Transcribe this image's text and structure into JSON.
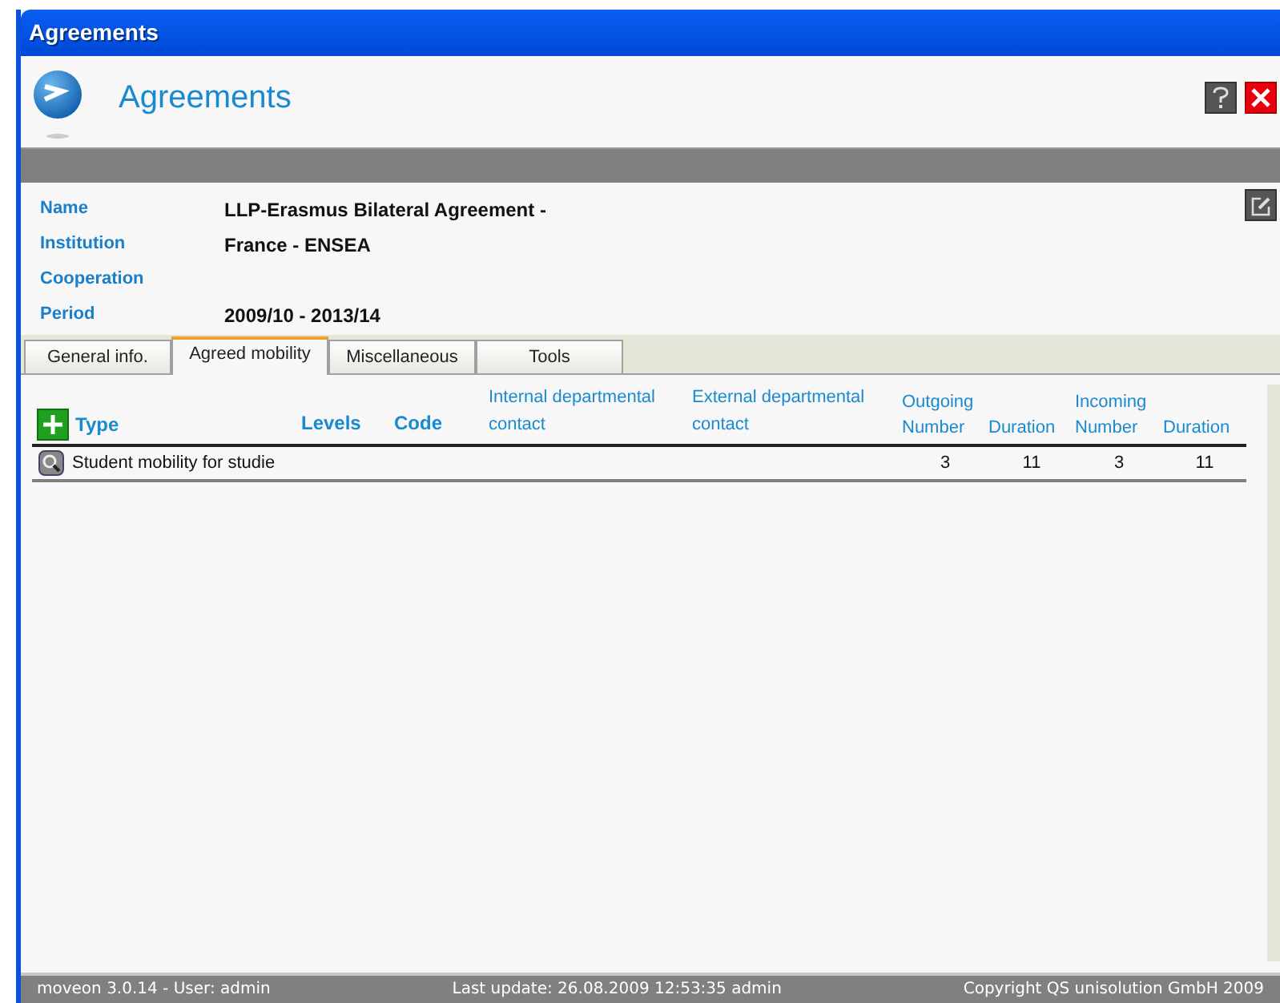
{
  "window": {
    "title": "Agreements"
  },
  "header": {
    "title": "Agreements"
  },
  "fields": [
    {
      "label": "Name",
      "value": "LLP-Erasmus Bilateral Agreement -"
    },
    {
      "label": "Institution",
      "value": "France - ENSEA"
    },
    {
      "label": "Cooperation"
    },
    {
      "label": "Period",
      "value": "2009/10 - 2013/14"
    }
  ],
  "tabs": [
    {
      "label": "General info.",
      "selected": false
    },
    {
      "label": "Agreed mobility",
      "selected": true
    },
    {
      "label": "Miscellaneous",
      "selected": false
    },
    {
      "label": "Tools",
      "selected": false
    }
  ],
  "table": {
    "column_groups": [
      {
        "label": "Outgoing"
      },
      {
        "label": "Incoming"
      }
    ],
    "columns": [
      {
        "label": "Type",
        "kind": "bold"
      },
      {
        "label": "Levels",
        "kind": "bold"
      },
      {
        "label": "Code",
        "kind": "bold"
      },
      {
        "label": "Internal departmental contact",
        "kind": "plain"
      },
      {
        "label": "External departmental contact",
        "kind": "plain"
      },
      {
        "label": "Number",
        "kind": "plain"
      },
      {
        "label": "Duration",
        "kind": "plain"
      },
      {
        "label": "Number",
        "kind": "plain"
      },
      {
        "label": "Duration",
        "kind": "plain"
      }
    ],
    "rows": [
      {
        "cells": [
          "Student mobility for studie",
          "",
          "",
          "",
          "",
          "3",
          "11",
          "3",
          "11"
        ]
      }
    ]
  },
  "status_bar": {
    "left": "moveon 3.0.14 - User: admin",
    "center": "Last update: 26.08.2009 12:53:35 admin",
    "right": "Copyright QS unisolution GmbH 2009"
  }
}
